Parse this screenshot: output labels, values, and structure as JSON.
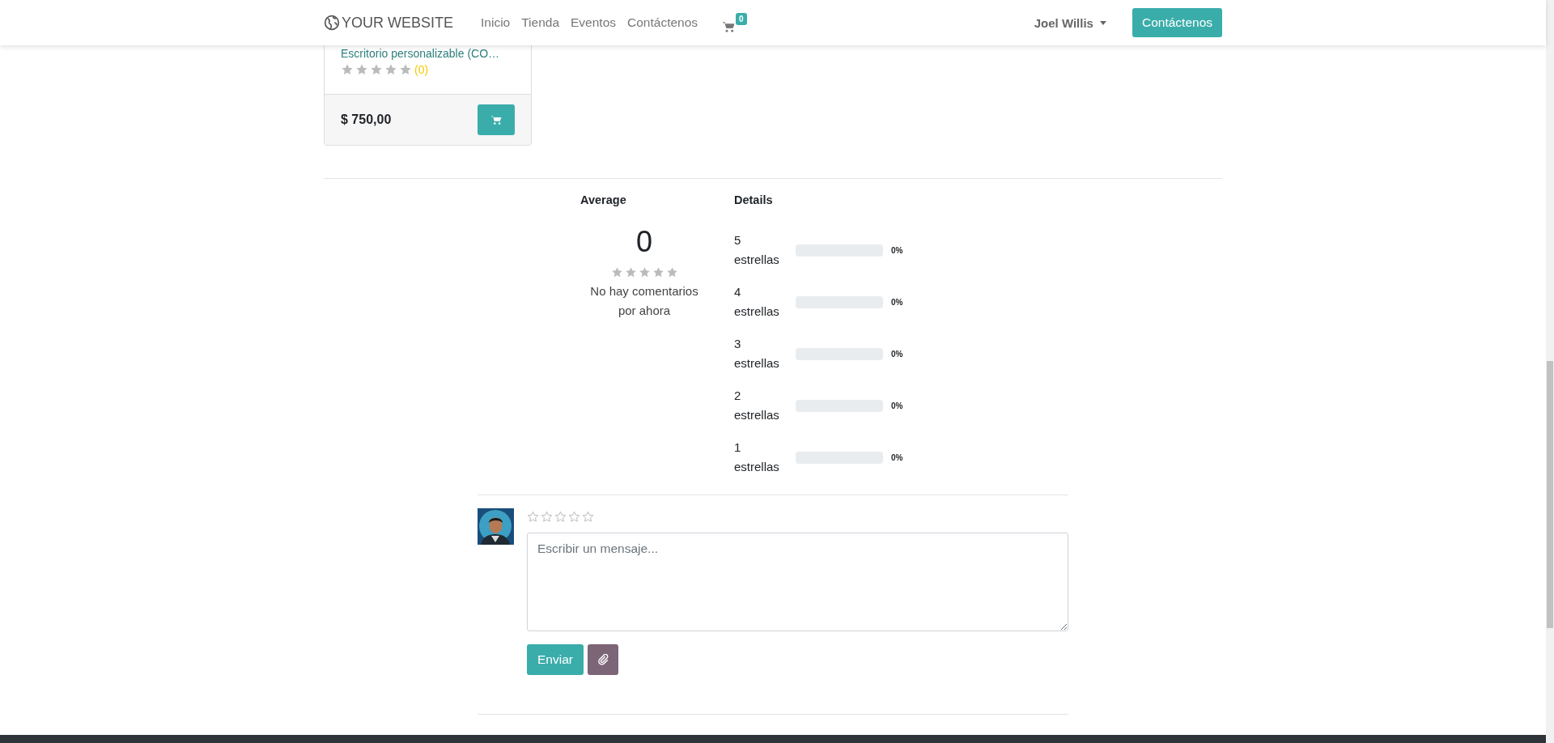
{
  "navbar": {
    "logo": "YOUR WEBSITE",
    "links": [
      {
        "label": "Inicio"
      },
      {
        "label": "Tienda"
      },
      {
        "label": "Eventos"
      },
      {
        "label": "Contáctenos"
      }
    ],
    "cart_count": "0",
    "user": "Joel Willis",
    "cta": "Contáctenos"
  },
  "product_card": {
    "title": "Escritorio personalizable (CO…",
    "stars": 0,
    "review_count": "(0)",
    "price": "$ 750,00"
  },
  "rating_summary": {
    "average_heading": "Average",
    "average": "0",
    "stars": 0,
    "no_reviews": "No hay comentarios por ahora",
    "details_heading": "Details",
    "rows": [
      {
        "label": "5 estrellas",
        "level": 0,
        "percent": "0%"
      },
      {
        "label": "4 estrellas",
        "level": 0,
        "percent": "0%"
      },
      {
        "label": "3 estrellas",
        "level": 0,
        "percent": "0%"
      },
      {
        "label": "2 estrellas",
        "level": 0,
        "percent": "0%"
      },
      {
        "label": "1 estrellas",
        "level": 0,
        "percent": "0%"
      }
    ]
  },
  "composer": {
    "stars": 0,
    "placeholder": "Escribir un mensaje...",
    "send": "Enviar"
  }
}
